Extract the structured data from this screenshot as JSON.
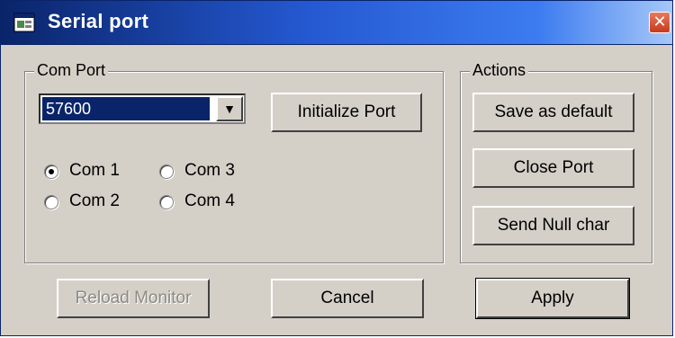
{
  "window": {
    "title": "Serial port",
    "close_symbol": "✕",
    "title_icon": "window-icon",
    "titlebar_color": "#0a246a",
    "accent_color": "#3c7bf0"
  },
  "com_port_group": {
    "legend": "Com Port",
    "baud_combo": {
      "value": "57600",
      "arrow": "▼"
    },
    "initialize_button": "Initialize Port",
    "radios": [
      {
        "label": "Com 1",
        "checked": true
      },
      {
        "label": "Com 3",
        "checked": false
      },
      {
        "label": "Com 2",
        "checked": false
      },
      {
        "label": "Com 4",
        "checked": false
      }
    ]
  },
  "actions_group": {
    "legend": "Actions",
    "save_default_button": "Save as default",
    "close_port_button": "Close Port",
    "send_null_button": "Send Null char"
  },
  "footer": {
    "reload_monitor_button": "Reload Monitor",
    "cancel_button": "Cancel",
    "apply_button": "Apply"
  }
}
